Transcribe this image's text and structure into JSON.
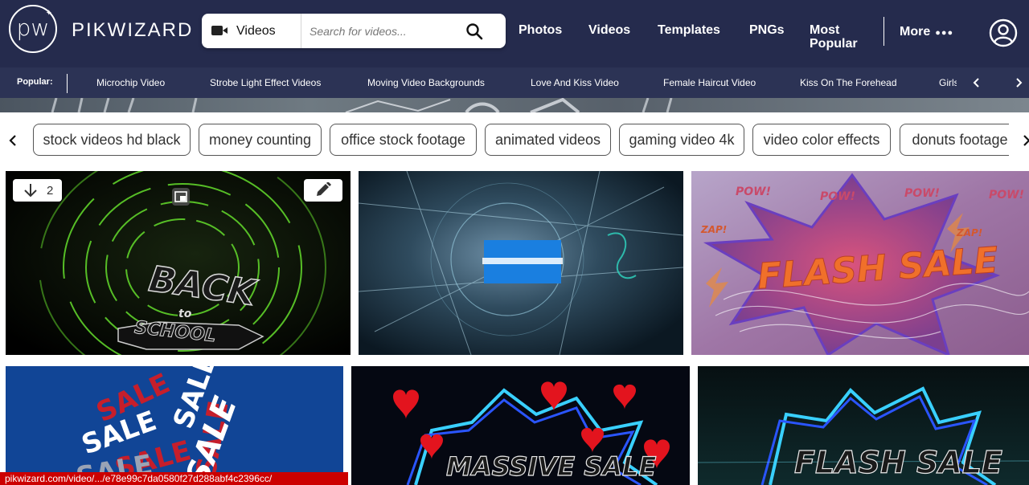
{
  "brand": {
    "logo_text": "pw",
    "name": "PIKWIZARD"
  },
  "search": {
    "type_label": "Videos",
    "placeholder": "Search for videos...",
    "value": ""
  },
  "nav": {
    "photos": "Photos",
    "videos": "Videos",
    "templates": "Templates",
    "pngs": "PNGs",
    "most_popular_line1": "Most",
    "most_popular_line2": "Popular",
    "more": "More",
    "more_dots": "●●●"
  },
  "popular": {
    "label": "Popular:",
    "items": [
      "Microchip Video",
      "Strobe Light Effect Videos",
      "Moving Video Backgrounds",
      "Love And Kiss Video",
      "Female Haircut Video",
      "Kiss On The Forehead",
      "Girls"
    ]
  },
  "tags": [
    "stock videos hd black",
    "money counting",
    "office stock footage",
    "animated videos",
    "gaming video 4k",
    "video color effects",
    "donuts footage"
  ],
  "cards": {
    "card1": {
      "download_count": "2",
      "line1": "BACK",
      "line2": "to",
      "line3": "SCHOOL"
    },
    "card3": {
      "text": "FLASH SALE",
      "pow": "POW!",
      "zap": "ZAP!"
    },
    "card4": {
      "text": "SALE"
    },
    "card5": {
      "text": "MASSIVE SALE"
    },
    "card6": {
      "text": "FLASH SALE"
    }
  },
  "status_url": "pikwizard.com/video/.../e78e99c7da0580f27d288abf4c2396cc/",
  "colors": {
    "nav_bg": "#252b4d",
    "popular_bg": "#2c3355",
    "status_bg": "#cc0000",
    "neon_cyan": "#39d0ff",
    "neon_blue": "#2a55ff",
    "flash_orange": "#f0702a"
  }
}
